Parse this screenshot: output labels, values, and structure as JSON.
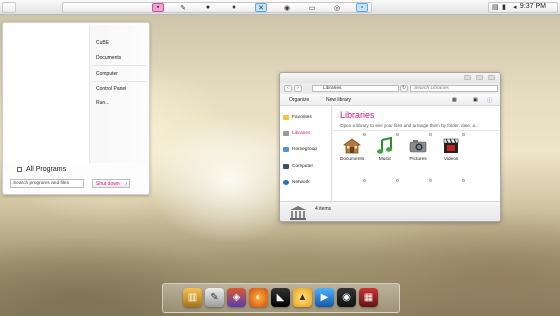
{
  "top_panel": {
    "clock": "9:37 PM"
  },
  "start_menu": {
    "links": [
      "CuBE",
      "Documents",
      "Computer",
      "Control Panel",
      "Run..."
    ],
    "all_programs": "All Programs",
    "search_placeholder": "Search programs and files",
    "shutdown": "Shut down"
  },
  "explorer": {
    "address": "Libraries",
    "search_placeholder": "Search Libraries",
    "toolbar": {
      "organize": "Organize",
      "new_library": "New library"
    },
    "nav": {
      "favorites": "Favorites",
      "libraries": "Libraries",
      "homegroup": "Homegroup",
      "computer": "Computer",
      "network": "Network"
    },
    "title": "Libraries",
    "subtitle": "Open a library to see your files and arrange them by folder, date, a...",
    "items": [
      {
        "label": "Documents",
        "icon": "documents-icon"
      },
      {
        "label": "Music",
        "icon": "music-icon"
      },
      {
        "label": "Pictures",
        "icon": "camera-icon"
      },
      {
        "label": "Videos",
        "icon": "clapperboard-icon"
      }
    ],
    "status": "4 items"
  },
  "colors": {
    "accent": "#d2177f",
    "panel": "#f0f0f0"
  }
}
